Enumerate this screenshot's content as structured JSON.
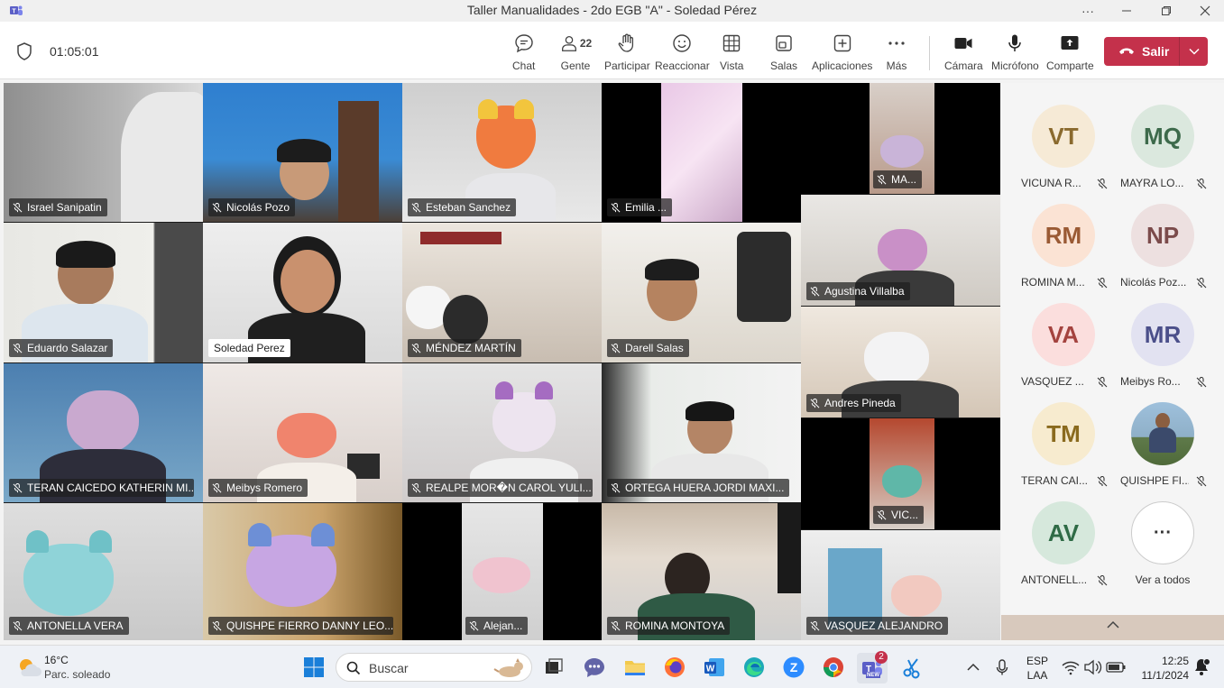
{
  "window": {
    "title": "Taller Manualidades - 2do EGB \"A\" - Soledad Pérez",
    "controls": [
      "more-icon",
      "minimize-icon",
      "restore-icon",
      "close-icon"
    ]
  },
  "meeting": {
    "elapsed": "01:05:01",
    "toolbar": {
      "chat": "Chat",
      "people": "Gente",
      "people_count": "22",
      "participate": "Participar",
      "react": "Reaccionar",
      "view": "Vista",
      "rooms": "Salas",
      "apps": "Aplicaciones",
      "more": "Más",
      "camera": "Cámara",
      "mic": "Micrófono",
      "share": "Comparte",
      "leave": "Salir"
    }
  },
  "tiles": [
    {
      "name": "Israel Sanipatin"
    },
    {
      "name": "Nicolás Pozo"
    },
    {
      "name": "Esteban Sanchez"
    },
    {
      "name": "Emilia ..."
    },
    {
      "name": "MA..."
    },
    {
      "name": "Eduardo Salazar"
    },
    {
      "name": "Soledad Perez"
    },
    {
      "name": "MÉNDEZ MARTÍN"
    },
    {
      "name": "Darell Salas"
    },
    {
      "name": "Agustina Villalba"
    },
    {
      "name": "Andres Pineda"
    },
    {
      "name": "TERAN CAICEDO KATHERIN MI..."
    },
    {
      "name": "Meibys Romero"
    },
    {
      "name": "REALPE MOR�N CAROL YULI..."
    },
    {
      "name": "ORTEGA HUERA JORDI MAXI..."
    },
    {
      "name": "VIC..."
    },
    {
      "name": "ANTONELLA VERA"
    },
    {
      "name": "QUISHPE FIERRO DANNY LEO..."
    },
    {
      "name": "Alejan..."
    },
    {
      "name": "ROMINA MONTOYA"
    },
    {
      "name": "VASQUEZ ALEJANDRO"
    }
  ],
  "roster": [
    {
      "initials": "VT",
      "name": "VICUNA R...",
      "bg": "#f6ead6",
      "fg": "#8a6a2e"
    },
    {
      "initials": "MQ",
      "name": "MAYRA LO...",
      "bg": "#dbe8de",
      "fg": "#3d6a4b"
    },
    {
      "initials": "RM",
      "name": "ROMINA M...",
      "bg": "#fbe3d4",
      "fg": "#9a5a34"
    },
    {
      "initials": "NP",
      "name": "Nicolás Poz...",
      "bg": "#ede0e0",
      "fg": "#7b4b4b"
    },
    {
      "initials": "VA",
      "name": "VASQUEZ ...",
      "bg": "#fbdedd",
      "fg": "#a4433f"
    },
    {
      "initials": "MR",
      "name": "Meibys Ro...",
      "bg": "#e2e2f1",
      "fg": "#4b4f8a"
    },
    {
      "initials": "TM",
      "name": "TERAN CAI...",
      "bg": "#f7ebcf",
      "fg": "#8a6a1e"
    },
    {
      "initials": "",
      "name": "QUISHPE FI...",
      "bg": "#7fa7c9",
      "fg": "#fff"
    },
    {
      "initials": "AV",
      "name": "ANTONELL...",
      "bg": "#d6e8dc",
      "fg": "#2f6b46"
    },
    {
      "initials": "···",
      "name": "Ver a todos",
      "bg": "#ffffff",
      "fg": "#333"
    }
  ],
  "taskbar": {
    "temp": "16°C",
    "condition": "Parc. soleado",
    "search_placeholder": "Buscar",
    "teams_badge": "2",
    "teams_new": "NEW",
    "lang_top": "ESP",
    "lang_bottom": "LAA",
    "time": "12:25",
    "date": "11/1/2024"
  }
}
